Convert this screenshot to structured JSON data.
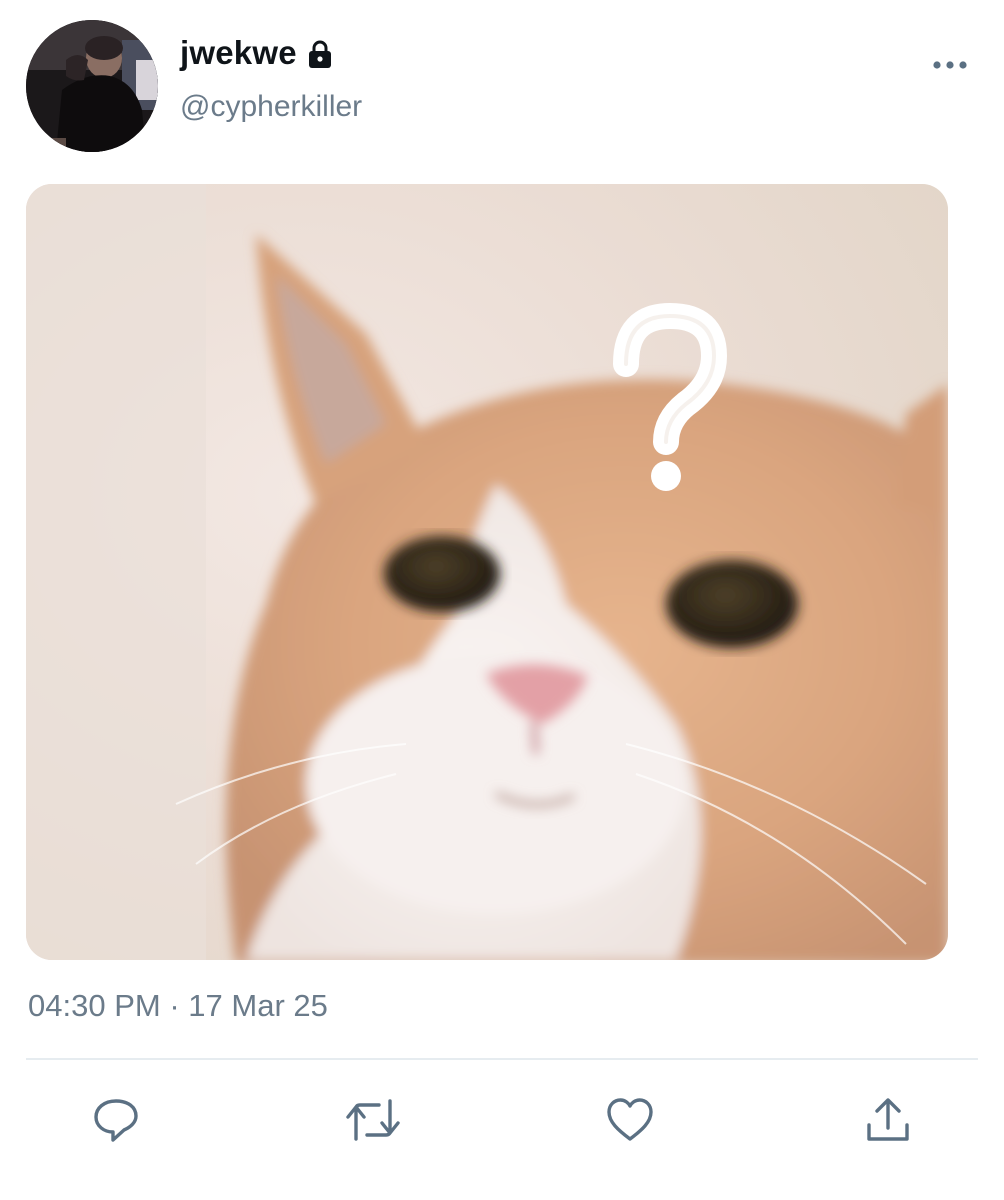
{
  "user": {
    "display_name": "jwekwe",
    "handle": "@cypherkiller",
    "protected_icon": "lock-icon",
    "avatar": "user-avatar-photo"
  },
  "menu": {
    "icon": "more-horizontal-icon"
  },
  "media": {
    "description_icon": "question-mark-overlay",
    "kind": "photo"
  },
  "meta": {
    "time": "04:30 PM",
    "separator": "·",
    "date": "17 Mar 25"
  },
  "actions": [
    {
      "name": "reply",
      "icon": "reply-icon"
    },
    {
      "name": "retweet",
      "icon": "retweet-icon"
    },
    {
      "name": "like",
      "icon": "heart-icon"
    },
    {
      "name": "share",
      "icon": "share-icon"
    }
  ],
  "colors": {
    "text_primary": "#0f1419",
    "text_secondary": "#6b7b8a",
    "icon": "#5b7083",
    "divider": "#e6ecf0"
  }
}
